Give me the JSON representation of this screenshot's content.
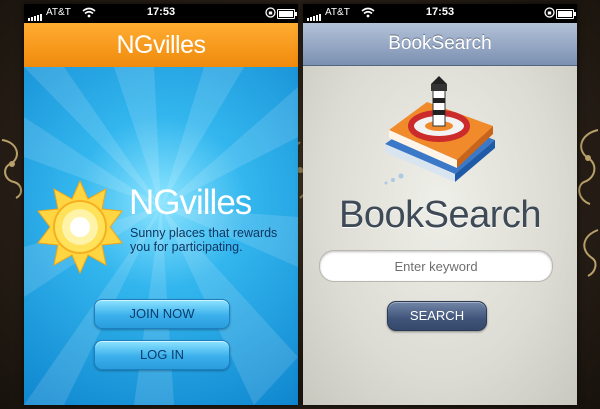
{
  "screens": [
    {
      "status": {
        "carrier": "AT&T",
        "time": "17:53"
      },
      "header_title": "NGvilles",
      "logo_text": "NGvilles",
      "tagline": "Sunny places that rewards you for participating.",
      "buttons": {
        "join": "JOIN NOW",
        "login": "LOG IN"
      },
      "colors": {
        "header": "#f5961a",
        "background": "#2eb1ec"
      }
    },
    {
      "status": {
        "carrier": "AT&T",
        "time": "17:53"
      },
      "header_title": "BookSearch",
      "logo_text": "BookSearch",
      "search": {
        "placeholder": "Enter keyword"
      },
      "buttons": {
        "search": "SEARCH"
      },
      "colors": {
        "header": "#98aac6",
        "background": "#e2e2dc",
        "button": "#3f5478"
      }
    }
  ]
}
